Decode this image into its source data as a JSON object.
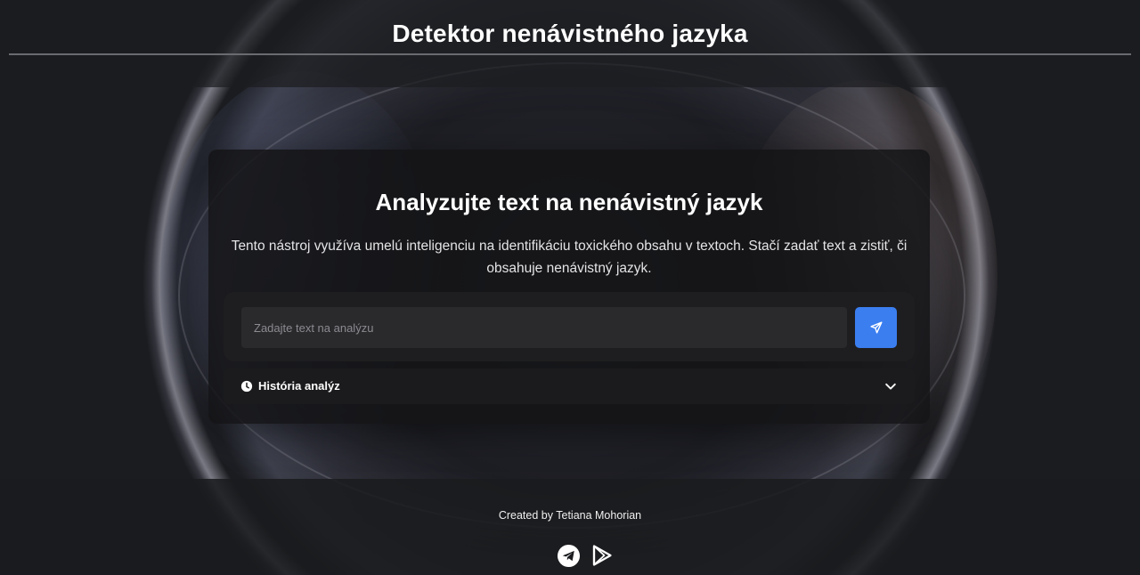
{
  "header": {
    "title": "Detektor nenávistného jazyka"
  },
  "card": {
    "title": "Analyzujte text na nenávistný jazyk",
    "description": "Tento nástroj využíva umelú inteligenciu na identifikáciu toxického obsahu v textoch. Stačí zadať text a zistiť, či obsahuje nenávistný jazyk.",
    "input": {
      "value": "",
      "placeholder": "Zadajte text na analýzu"
    },
    "send_button": {
      "icon": "send-icon",
      "color": "#3b7ef0"
    },
    "history": {
      "label": "História analýz",
      "icon": "clock-icon",
      "toggle_icon": "chevron-down-icon",
      "expanded": false
    }
  },
  "footer": {
    "credit": "Created by Tetiana Mohorian",
    "links": [
      {
        "icon": "telegram-icon"
      },
      {
        "icon": "google-play-icon"
      }
    ]
  },
  "colors": {
    "accent": "#3b7ef0",
    "background": "#1a1b1e",
    "card": "#141416"
  }
}
